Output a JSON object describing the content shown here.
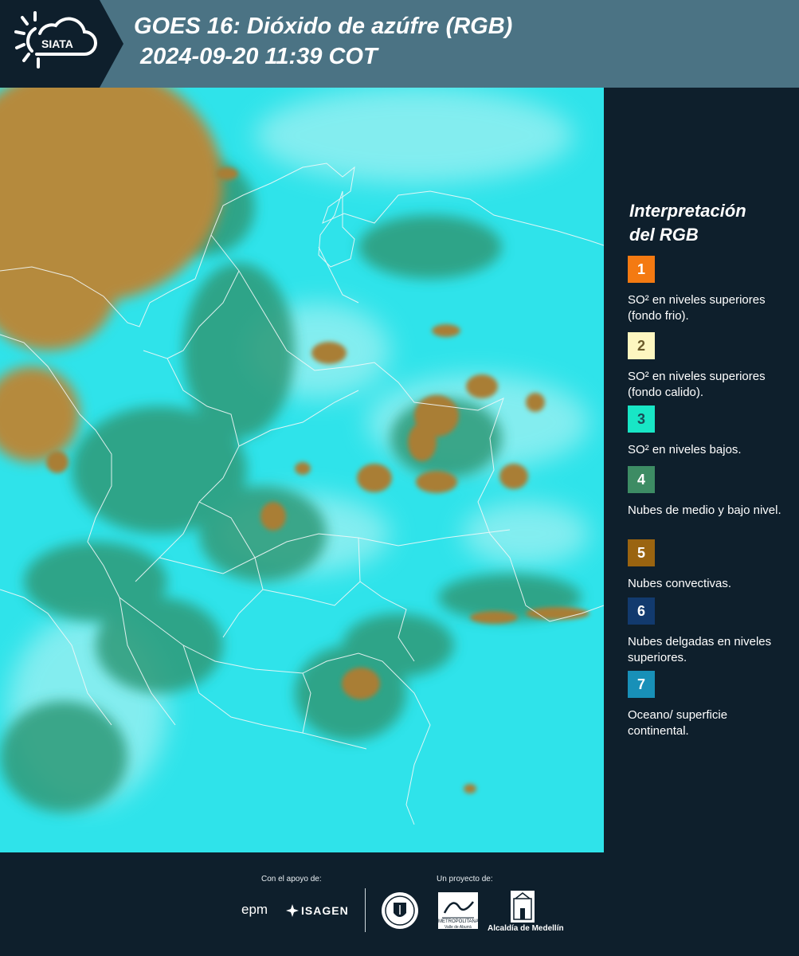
{
  "header": {
    "logo_text": "SIATA",
    "title_line1": "GOES 16: Dióxido de azúfre (RGB)",
    "title_line2": "2024-09-20 11:39 COT"
  },
  "legend": {
    "title_line1": "Interpretación",
    "title_line2": "del RGB",
    "items": [
      {
        "number": "1",
        "color": "#f47a12",
        "text_color": "#ffffff",
        "text": "SO² en niveles superiores (fondo frio)."
      },
      {
        "number": "2",
        "color": "#fdf6c0",
        "text_color": "#6b5a2a",
        "text": "SO² en niveles superiores (fondo calido)."
      },
      {
        "number": "3",
        "color": "#18e6c6",
        "text_color": "#1a4b57",
        "text": "SO² en niveles bajos."
      },
      {
        "number": "4",
        "color": "#3d8c64",
        "text_color": "#ffffff",
        "text": "Nubes de medio y bajo nivel."
      },
      {
        "number": "5",
        "color": "#9a6410",
        "text_color": "#ffffff",
        "text": "Nubes convectivas."
      },
      {
        "number": "6",
        "color": "#123a6e",
        "text_color": "#ffffff",
        "text": "Nubes delgadas en niveles superiores."
      },
      {
        "number": "7",
        "color": "#1890b8",
        "text_color": "#ffffff",
        "text": "Oceano/ superficie continental."
      }
    ]
  },
  "footer": {
    "support_label": "Con el apoyo de:",
    "project_label": "Un proyecto de:",
    "epm": "epm",
    "isagen": "ISAGEN",
    "area_metropolitana": "METROPOLITANA",
    "area_sub": "Valle de Aburrá",
    "alcaldia": "Alcaldía de Medellín"
  }
}
